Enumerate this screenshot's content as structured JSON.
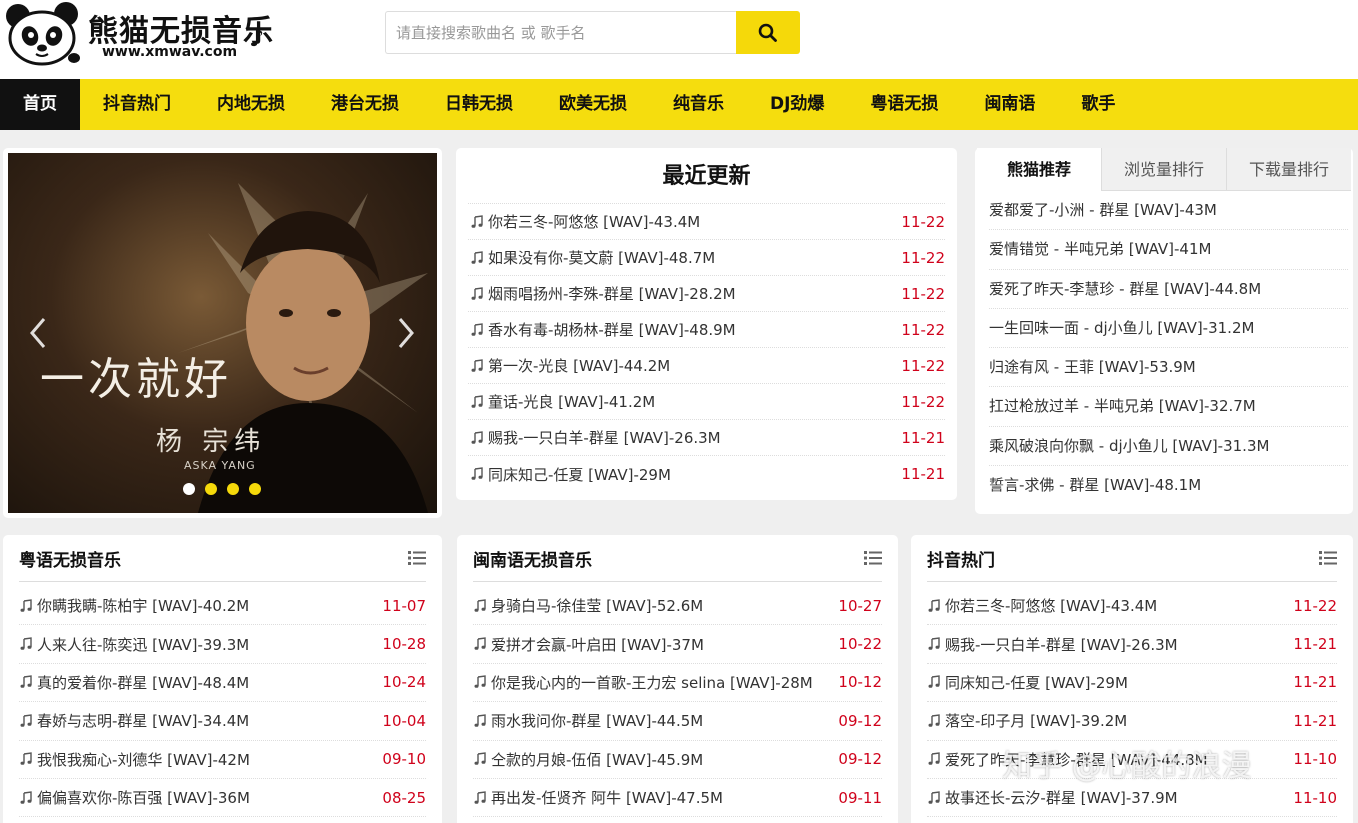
{
  "brand": {
    "logo_text": "熊猫无损音乐",
    "url_text": "www.xmwav.com",
    "colors": {
      "accent": "#f5dd0e",
      "date": "#d0021b",
      "active_nav": "#111111"
    }
  },
  "search": {
    "placeholder": "请直接搜索歌曲名 或 歌手名",
    "value": "",
    "button_icon": "search-icon"
  },
  "nav": {
    "items": [
      {
        "label": "首页",
        "active": true
      },
      {
        "label": "抖音热门"
      },
      {
        "label": "内地无损"
      },
      {
        "label": "港台无损"
      },
      {
        "label": "日韩无损"
      },
      {
        "label": "欧美无损"
      },
      {
        "label": "纯音乐"
      },
      {
        "label": "DJ劲爆"
      },
      {
        "label": "粤语无损"
      },
      {
        "label": "闽南语"
      },
      {
        "label": "歌手"
      }
    ]
  },
  "carousel": {
    "slide_title": "一次就好",
    "slide_artist": "杨 宗纬",
    "slide_sub": "ASKA YANG",
    "dots": 4,
    "active_dot": 0,
    "prev_icon": "chevron-left-icon",
    "next_icon": "chevron-right-icon"
  },
  "latest": {
    "title": "最近更新",
    "items": [
      {
        "song": "你若三冬-阿悠悠  [WAV]-43.4M",
        "date": "11-22"
      },
      {
        "song": "如果没有你-莫文蔚  [WAV]-48.7M",
        "date": "11-22"
      },
      {
        "song": "烟雨唱扬州-李殊-群星  [WAV]-28.2M",
        "date": "11-22"
      },
      {
        "song": "香水有毒-胡杨林-群星  [WAV]-48.9M",
        "date": "11-22"
      },
      {
        "song": "第一次-光良  [WAV]-44.2M",
        "date": "11-22"
      },
      {
        "song": "童话-光良  [WAV]-41.2M",
        "date": "11-22"
      },
      {
        "song": "赐我-一只白羊-群星  [WAV]-26.3M",
        "date": "11-21"
      },
      {
        "song": "同床知己-任夏  [WAV]-29M",
        "date": "11-21"
      }
    ]
  },
  "recommend": {
    "tabs": [
      {
        "label": "熊猫推荐",
        "active": true
      },
      {
        "label": "浏览量排行"
      },
      {
        "label": "下载量排行"
      }
    ],
    "items": [
      "爱都爱了-小洲 - 群星  [WAV]-43M",
      "爱情错觉 - 半吨兄弟  [WAV]-41M",
      "爱死了昨天-李慧珍 - 群星  [WAV]-44.8M",
      "一生回味一面 - dj小鱼儿  [WAV]-31.2M",
      "归途有风 - 王菲  [WAV]-53.9M",
      "扛过枪放过羊 - 半吨兄弟  [WAV]-32.7M",
      "乘风破浪向你飘 - dj小鱼儿  [WAV]-31.3M",
      "誓言-求佛 - 群星  [WAV]-48.1M"
    ]
  },
  "lists": [
    {
      "title": "粤语无损音乐",
      "items": [
        {
          "song": "你瞒我瞒-陈柏宇  [WAV]-40.2M",
          "date": "11-07"
        },
        {
          "song": "人来人往-陈奕迅  [WAV]-39.3M",
          "date": "10-28"
        },
        {
          "song": "真的爱着你-群星  [WAV]-48.4M",
          "date": "10-24"
        },
        {
          "song": "春娇与志明-群星  [WAV]-34.4M",
          "date": "10-04"
        },
        {
          "song": "我恨我痴心-刘德华  [WAV]-42M",
          "date": "09-10"
        },
        {
          "song": "偏偏喜欢你-陈百强  [WAV]-36M",
          "date": "08-25"
        }
      ]
    },
    {
      "title": "闽南语无损音乐",
      "items": [
        {
          "song": "身骑白马-徐佳莹  [WAV]-52.6M",
          "date": "10-27"
        },
        {
          "song": "爱拼才会赢-叶启田  [WAV]-37M",
          "date": "10-22"
        },
        {
          "song": "你是我心内的一首歌-王力宏 selina [WAV]-28M",
          "date": "10-12"
        },
        {
          "song": "雨水我问你-群星  [WAV]-44.5M",
          "date": "09-12"
        },
        {
          "song": "仝款的月娘-伍佰  [WAV]-45.9M",
          "date": "09-12"
        },
        {
          "song": "再出发-任贤齐 阿牛 [WAV]-47.5M",
          "date": "09-11"
        }
      ]
    },
    {
      "title": "抖音热门",
      "items": [
        {
          "song": "你若三冬-阿悠悠  [WAV]-43.4M",
          "date": "11-22"
        },
        {
          "song": "赐我-一只白羊-群星  [WAV]-26.3M",
          "date": "11-21"
        },
        {
          "song": "同床知己-任夏  [WAV]-29M",
          "date": "11-21"
        },
        {
          "song": "落空-印子月  [WAV]-39.2M",
          "date": "11-21"
        },
        {
          "song": "爱死了昨天-李慧珍-群星  [WAV]-44.8M",
          "date": "11-10"
        },
        {
          "song": "故事还长-云汐-群星  [WAV]-37.9M",
          "date": "11-10"
        }
      ]
    }
  ],
  "watermark": "知乎 @心酸的浪漫"
}
